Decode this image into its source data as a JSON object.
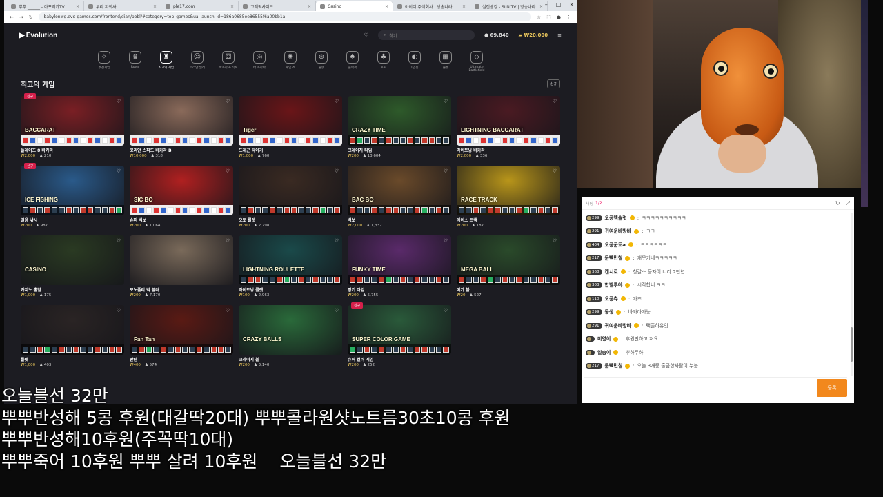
{
  "browser": {
    "tabs": [
      {
        "title": "뿌뿌 ______ - 아프리카TV"
      },
      {
        "title": "우리 자회사"
      },
      {
        "title": "ple17.com"
      },
      {
        "title": "그래픽사이트"
      },
      {
        "title": "Casino"
      },
      {
        "title": "아이티 주식회사 | 방송나라"
      },
      {
        "title": "실전뱅킹 - SLN TV | 방송나라"
      }
    ],
    "url": "babylonwg.evo-games.com/frontend/dian/pobl/#category=top_games&ua_launch_id=186a0685ee86555f6a00bb1a"
  },
  "evo": {
    "logo": "Evolution",
    "search_placeholder": "찾기",
    "balance": "69,840",
    "bet_balance": "₩20,000",
    "categories": [
      {
        "label": "추천게임",
        "icon": "✧"
      },
      {
        "label": "Royal",
        "icon": "♛"
      },
      {
        "label": "최고의 게임",
        "icon": "♜"
      },
      {
        "label": "코리안 딜러",
        "icon": "☺"
      },
      {
        "label": "바카라 & 식보",
        "icon": "⚃"
      },
      {
        "label": "바 카라바",
        "icon": "◎"
      },
      {
        "label": "게임 쇼",
        "icon": "✺"
      },
      {
        "label": "룰렛",
        "icon": "⊛"
      },
      {
        "label": "블랙잭",
        "icon": "♠"
      },
      {
        "label": "포커",
        "icon": "♣"
      },
      {
        "label": "1인칭",
        "icon": "◐"
      },
      {
        "label": "슬롯",
        "icon": "▦"
      },
      {
        "label": "Ultimate Battlefield",
        "icon": "◇"
      }
    ],
    "section_title": "최고의 게임",
    "new_label": "신규",
    "games": [
      {
        "name": "플레이즈 8 바카라",
        "bet": "₩2,000",
        "players": "210",
        "new": true,
        "bg": "#7a1f24",
        "label": "BACCARAT",
        "strip": "light"
      },
      {
        "name": "코리안 스피드 바카라 B",
        "bet": "₩10,000",
        "players": "318",
        "new": false,
        "bg": "#8a6a5a",
        "label": "",
        "strip": "light"
      },
      {
        "name": "드래곤 타이거",
        "bet": "₩1,000",
        "players": "760",
        "new": false,
        "bg": "#6a1518",
        "label": "Tiger",
        "strip": "light"
      },
      {
        "name": "크레이지 타임",
        "bet": "₩200",
        "players": "13,604",
        "new": false,
        "bg": "#2e5a2a",
        "label": "CRAZY TIME",
        "strip": "dark"
      },
      {
        "name": "라이트닝 바카라",
        "bet": "₩2,000",
        "players": "336",
        "new": false,
        "bg": "#4a1a22",
        "label": "LIGHTNING BACCARAT",
        "strip": "light"
      },
      {
        "name": "얼음 낚시",
        "bet": "₩200",
        "players": "987",
        "new": true,
        "bg": "#2a5a8a",
        "label": "ICE FISHING",
        "strip": "dark"
      },
      {
        "name": "슈퍼 식보",
        "bet": "₩200",
        "players": "1,064",
        "new": false,
        "bg": "#b02020",
        "label": "SIC BO",
        "strip": "light"
      },
      {
        "name": "오토 룰렛",
        "bet": "₩200",
        "players": "2,798",
        "new": false,
        "bg": "#3a2a22",
        "label": "",
        "strip": "dark"
      },
      {
        "name": "백보",
        "bet": "₩2,000",
        "players": "1,332",
        "new": false,
        "bg": "#6a4a2a",
        "label": "BAC BO",
        "strip": "dark"
      },
      {
        "name": "레이스 트랙",
        "bet": "₩200",
        "players": "187",
        "new": false,
        "bg": "#b8951a",
        "label": "RACE TRACK",
        "strip": "dark"
      },
      {
        "name": "카지노 홀덤",
        "bet": "₩1,000",
        "players": "175",
        "new": false,
        "bg": "#2a3a22",
        "label": "CASINO",
        "strip": "none"
      },
      {
        "name": "모노폴리 빅 볼러",
        "bet": "₩200",
        "players": "7,170",
        "new": false,
        "bg": "#7a6a5a",
        "label": "",
        "strip": "none"
      },
      {
        "name": "라이트닝 룰렛",
        "bet": "₩100",
        "players": "2,963",
        "new": false,
        "bg": "#1a4a4a",
        "label": "LIGHTNING ROULETTE",
        "strip": "dark"
      },
      {
        "name": "펑키 타임",
        "bet": "₩200",
        "players": "5,755",
        "new": false,
        "bg": "#5a2a6a",
        "label": "FUNKY TIME",
        "strip": "dark"
      },
      {
        "name": "메가 볼",
        "bet": "₩20",
        "players": "527",
        "new": false,
        "bg": "#2a4a2a",
        "label": "MEGA BALL",
        "strip": "dark"
      },
      {
        "name": "룰렛",
        "bet": "₩1,000",
        "players": "403",
        "new": false,
        "bg": "#2a2424",
        "label": "",
        "strip": "dark"
      },
      {
        "name": "판탄",
        "bet": "₩400",
        "players": "574",
        "new": false,
        "bg": "#5a1a14",
        "label": "Fan Tan",
        "strip": "dark"
      },
      {
        "name": "크레이지 볼",
        "bet": "₩200",
        "players": "3,140",
        "new": false,
        "bg": "#2a6a3a",
        "label": "CRAZY BALLS",
        "strip": "none"
      },
      {
        "name": "슈퍼 컬러 게임",
        "bet": "₩200",
        "players": "252",
        "new": true,
        "bg": "#2a5a3a",
        "label": "SUPER COLOR GAME",
        "strip": "dark"
      }
    ]
  },
  "chat": {
    "header_label": "채팅",
    "header_count": "1/2",
    "messages": [
      {
        "level": "299",
        "nick": "오공맥슬럿",
        "text": "ㅋㅋㅋㅋㅋㅋㅋㅋㅋㅋ"
      },
      {
        "level": "291",
        "nick": "귀여운바방바",
        "text": "ㅋㅋ"
      },
      {
        "level": "404",
        "nick": "오공군도a",
        "text": "ㅋㅋㅋㅋㅋㅋ"
      },
      {
        "level": "217",
        "nick": "문빽민칠",
        "text": "개웃기네ㅋㅋㅋㅋㅋ"
      },
      {
        "level": "368",
        "nick": "켄시로",
        "text": "청갈소 등자이 너라 2만년"
      },
      {
        "level": "303",
        "nick": "합벨루야",
        "text": "시작합니 ㅋㅋ"
      },
      {
        "level": "110",
        "nick": "오공츄",
        "text": "가즈"
      },
      {
        "level": "299",
        "nick": "동생",
        "text": "바카라가능"
      },
      {
        "level": "291",
        "nick": "귀여운바방바",
        "text": "택출하유잇"
      },
      {
        "level": "",
        "nick": "미영이",
        "text": "후원만하고 쳐요"
      },
      {
        "level": "",
        "nick": "일송이",
        "text": "뿌하두하"
      },
      {
        "level": "217",
        "nick": "문빽민칠",
        "text": "오늘 3개중 출금한사람이 누분"
      }
    ],
    "send_label": "등록"
  },
  "subtitles": [
    "오늘블선 32만",
    "뿌뿌반성해 5콩 후원(대갈딱20대)  뿌뿌콜라원샷노트름30초10콩 후원",
    "뿌뿌반성해10후원(주꼭딱10대)",
    [
      "뿌뿌죽어 10후원 뿌뿌 살려 10후원",
      "오늘블선 32만"
    ]
  ]
}
